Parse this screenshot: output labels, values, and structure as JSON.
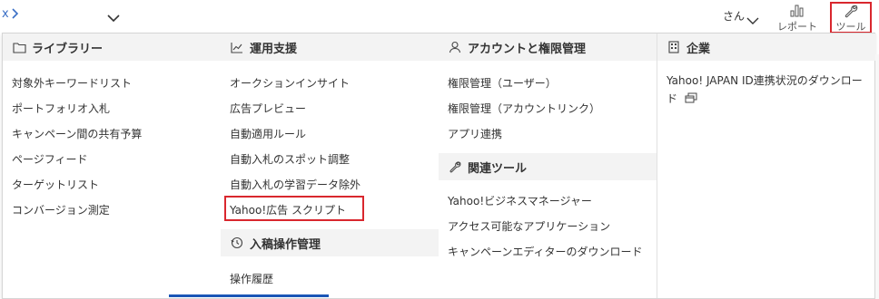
{
  "topbar": {
    "left_text": "x",
    "user_label": "さん",
    "report_label": "レポート",
    "tool_label": "ツール"
  },
  "menu": {
    "library": {
      "title": "ライブラリー",
      "icon": "folder-icon",
      "items": [
        "対象外キーワードリスト",
        "ポートフォリオ入札",
        "キャンペーン間の共有予算",
        "ページフィード",
        "ターゲットリスト",
        "コンバージョン測定"
      ]
    },
    "operation": {
      "title": "運用支援",
      "icon": "chart-line-icon",
      "items": [
        "オークションインサイト",
        "広告プレビュー",
        "自動適用ルール",
        "自動入札のスポット調整",
        "自動入札の学習データ除外",
        "Yahoo!広告 スクリプト"
      ]
    },
    "history": {
      "title": "入稿操作管理",
      "icon": "history-icon",
      "items": [
        "操作履歴"
      ]
    },
    "account": {
      "title": "アカウントと権限管理",
      "icon": "person-icon",
      "items": [
        "権限管理（ユーザー）",
        "権限管理（アカウントリンク）",
        "アプリ連携"
      ]
    },
    "related": {
      "title": "関連ツール",
      "icon": "wrench-icon",
      "items": [
        "Yahoo!ビジネスマネージャー",
        "アクセス可能なアプリケーション",
        "キャンペーンエディターのダウンロード"
      ]
    },
    "company": {
      "title": "企業",
      "icon": "building-icon",
      "items": [
        "Yahoo! JAPAN ID連携状況のダウンロード"
      ]
    }
  }
}
